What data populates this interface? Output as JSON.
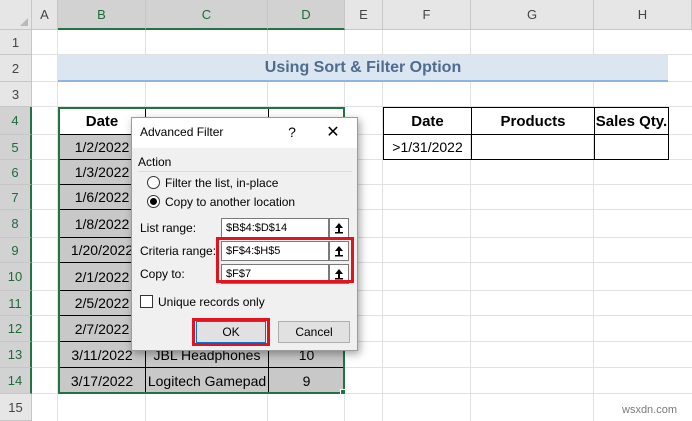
{
  "columns": [
    "A",
    "B",
    "C",
    "D",
    "E",
    "F",
    "G",
    "H"
  ],
  "rows": [
    "1",
    "2",
    "3",
    "4",
    "5",
    "6",
    "7",
    "8",
    "9",
    "10",
    "11",
    "12",
    "13",
    "14",
    "15"
  ],
  "title": "Using Sort & Filter Option",
  "data_table": {
    "headers": [
      "Date",
      "",
      ""
    ],
    "rows": [
      [
        "1/2/2022",
        "",
        ""
      ],
      [
        "1/3/2022",
        "",
        ""
      ],
      [
        "1/6/2022",
        "",
        ""
      ],
      [
        "1/8/2022",
        "",
        ""
      ],
      [
        "1/20/2022",
        "",
        ""
      ],
      [
        "2/1/2022",
        "",
        ""
      ],
      [
        "2/5/2022",
        "",
        ""
      ],
      [
        "2/7/2022",
        "",
        ""
      ],
      [
        "3/11/2022",
        "JBL Headphones",
        "10"
      ],
      [
        "3/17/2022",
        "Logitech Gamepad",
        "9"
      ]
    ]
  },
  "criteria_table": {
    "headers": [
      "Date",
      "Products",
      "Sales Qty."
    ],
    "row": [
      ">1/31/2022",
      "",
      ""
    ]
  },
  "dialog": {
    "title": "Advanced Filter",
    "help": "?",
    "close": "✕",
    "action_label": "Action",
    "radio_filter_in_place": "Filter the list, in-place",
    "radio_copy_to_location": "Copy to another location",
    "list_range_label": "List range:",
    "list_range_value": "$B$4:$D$14",
    "criteria_range_label": "Criteria range:",
    "criteria_range_value": "$F$4:$H$5",
    "copy_to_label": "Copy to:",
    "copy_to_value": "$F$7",
    "unique_records_label": "Unique records only",
    "ok_label": "OK",
    "cancel_label": "Cancel",
    "selected_action": "copy_to_location",
    "unique_records_checked": false,
    "ref_button_icon": "collapse-dialog-icon"
  },
  "colors": {
    "selection_green": "#217346",
    "highlight_red": "#e0141e",
    "banner_fill": "#dce6f1",
    "banner_text": "#4e6c8e",
    "gray_fill": "#c8c8c8"
  },
  "watermark": "wsxdn.com"
}
